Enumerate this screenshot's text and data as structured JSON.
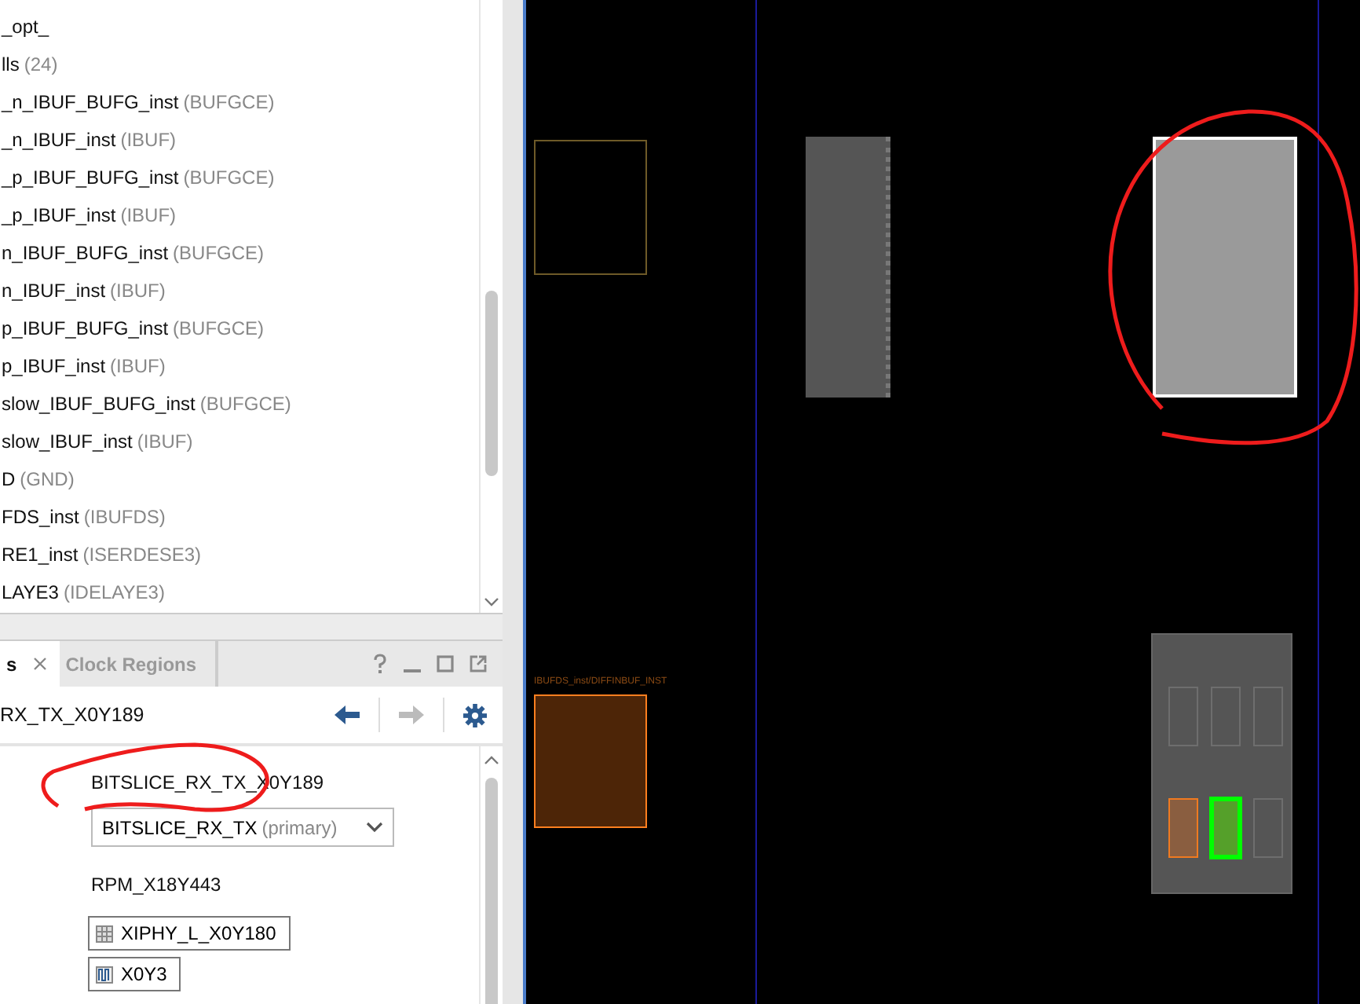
{
  "tree": {
    "rows": [
      {
        "name": "_opt_"
      },
      {
        "name": "lls",
        "type": "(24)"
      },
      {
        "name": "_n_IBUF_BUFG_inst",
        "type": "(BUFGCE)"
      },
      {
        "name": "_n_IBUF_inst",
        "type": "(IBUF)"
      },
      {
        "name": "_p_IBUF_BUFG_inst",
        "type": "(BUFGCE)"
      },
      {
        "name": "_p_IBUF_inst",
        "type": "(IBUF)"
      },
      {
        "name": "n_IBUF_BUFG_inst",
        "type": "(BUFGCE)"
      },
      {
        "name": "n_IBUF_inst",
        "type": "(IBUF)"
      },
      {
        "name": "p_IBUF_BUFG_inst",
        "type": "(BUFGCE)"
      },
      {
        "name": "p_IBUF_inst",
        "type": "(IBUF)"
      },
      {
        "name": "slow_IBUF_BUFG_inst",
        "type": "(BUFGCE)"
      },
      {
        "name": "slow_IBUF_inst",
        "type": "(IBUF)"
      },
      {
        "name": "D",
        "type": "(GND)"
      },
      {
        "name": "FDS_inst",
        "type": "(IBUFDS)"
      },
      {
        "name": "RE1_inst",
        "type": "(ISERDESE3)"
      },
      {
        "name": "LAYE3",
        "type": "(IDELAYE3)"
      }
    ]
  },
  "properties": {
    "tabs": [
      {
        "label": "s",
        "selected": true
      },
      {
        "label": "Clock Regions",
        "selected": false
      }
    ],
    "title": "RX_TX_X0Y189",
    "forward_disabled": true,
    "fields": [
      {
        "kind": "text",
        "value": "BITSLICE_RX_TX_X0Y189"
      },
      {
        "kind": "dropdown",
        "value": "BITSLICE_RX_TX",
        "note": "(primary)"
      },
      {
        "kind": "text",
        "value": "RPM_X18Y443"
      },
      {
        "kind": "tile-link",
        "value": "XIPHY_L_X0Y180"
      },
      {
        "kind": "clock-link",
        "value": "X0Y3"
      }
    ]
  },
  "canvas": {
    "block_label": "IBUFDS_inst/DIFFINBUF_INST"
  }
}
